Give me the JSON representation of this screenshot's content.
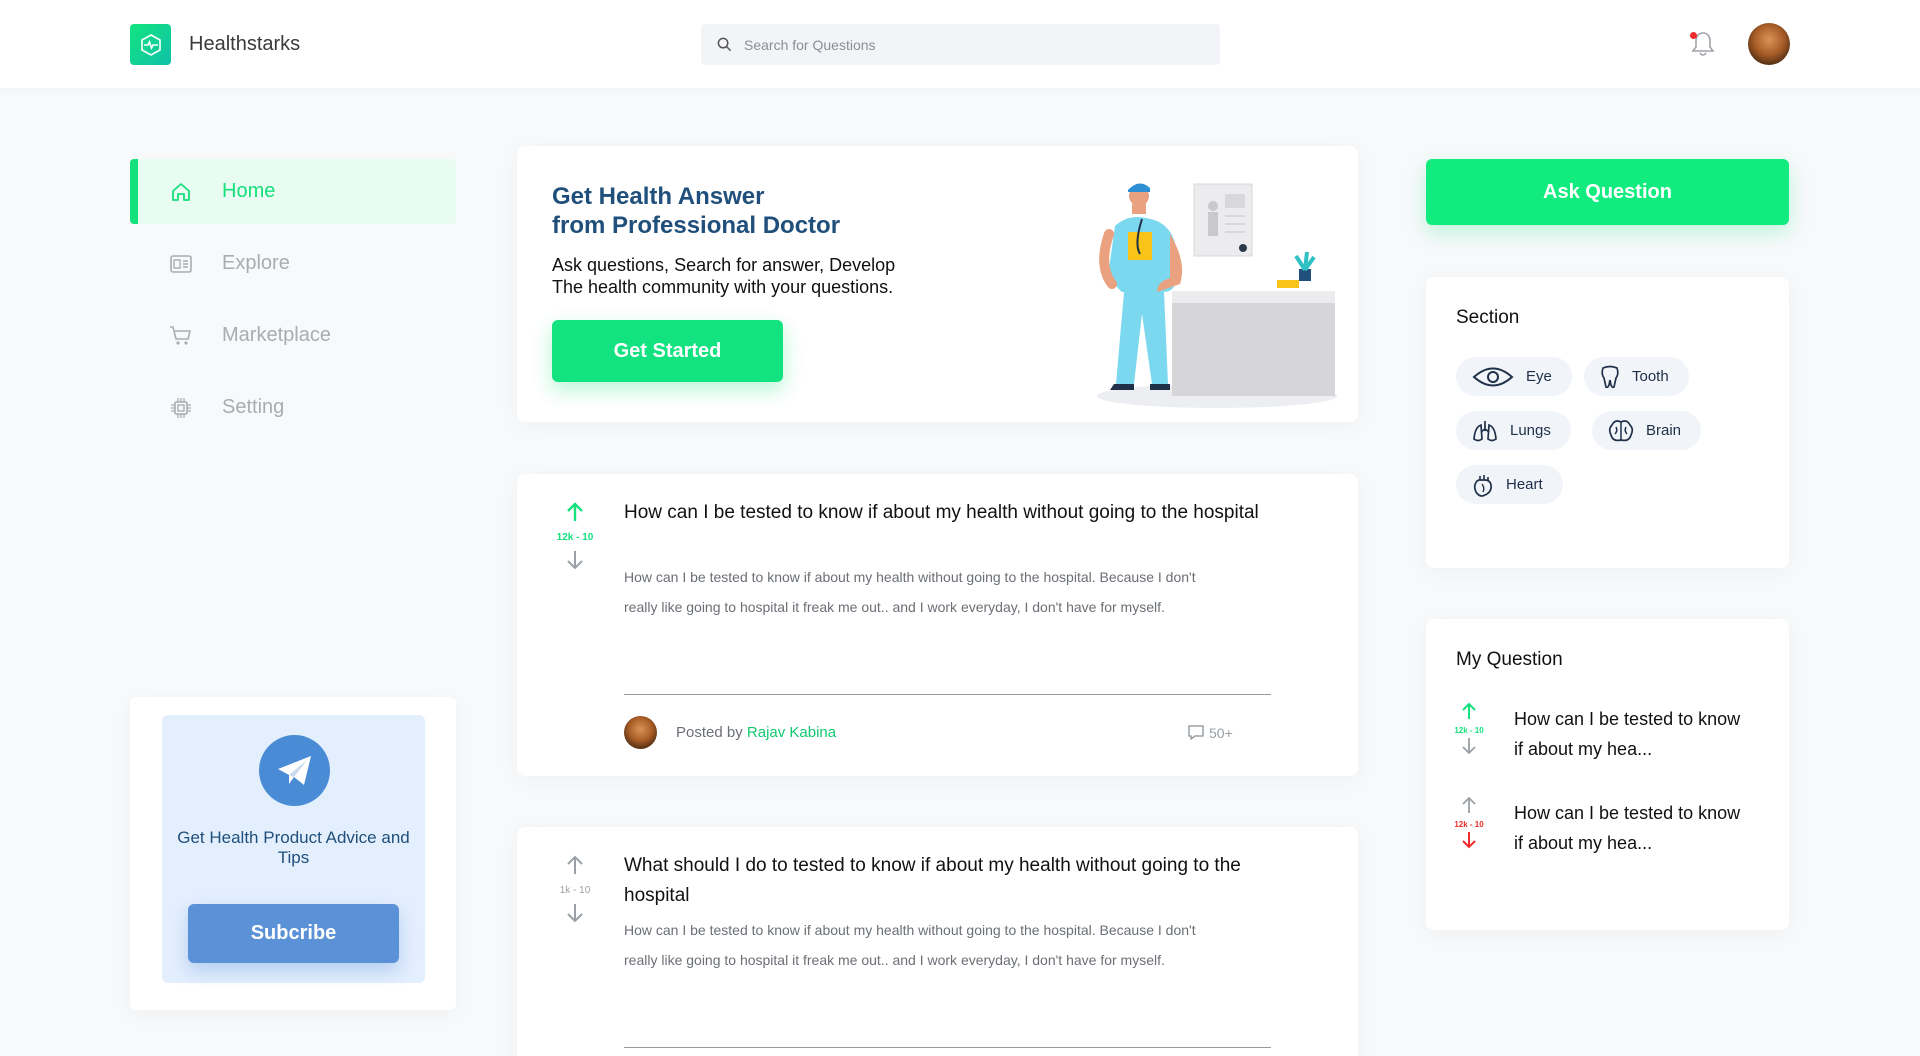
{
  "header": {
    "brand": "Healthstarks",
    "search_placeholder": "Search for Questions"
  },
  "sidebar": {
    "items": [
      {
        "label": "Home",
        "icon": "home-icon",
        "active": true
      },
      {
        "label": "Explore",
        "icon": "explore-icon",
        "active": false
      },
      {
        "label": "Marketplace",
        "icon": "cart-icon",
        "active": false
      },
      {
        "label": "Setting",
        "icon": "chip-icon",
        "active": false
      }
    ],
    "promo": {
      "text": "Get Health Product Advice and Tips",
      "button": "Subcribe",
      "icon": "telegram-icon"
    }
  },
  "hero": {
    "title": "Get Health Answer\nfrom Professional Doctor",
    "subtitle": "Ask questions, Search for answer, Develop\nThe health community with your questions.",
    "button": "Get Started"
  },
  "questions": [
    {
      "votes": "12k - 10",
      "title": "How can I be tested to know if about my health without going to the hospital",
      "body": "How can I be tested to know if about my health without going to the hospital. Because I don't really like going to hospital it freak me out.. and I work everyday, I don't have for myself.",
      "posted_by_label": "Posted by",
      "author": "Rajav Kabina",
      "comments": "50+"
    },
    {
      "votes": "1k - 10",
      "title": "What should I do to tested to know if about my health without going to the hospital",
      "body": "How can I be tested to know if about my health without going to the hospital. Because I don't really like going to hospital it freak me out.. and I work everyday, I don't have for myself."
    }
  ],
  "right": {
    "ask_button": "Ask Question",
    "section_title": "Section",
    "tags": [
      "Eye",
      "Tooth",
      "Lungs",
      "Brain",
      "Heart"
    ],
    "my_question_title": "My Question",
    "my_questions": [
      {
        "votes": "12k - 10",
        "title": "How can I be tested to know if about my hea...",
        "state": "up"
      },
      {
        "votes": "12k - 10",
        "title": "How can I be tested to know if about my hea...",
        "state": "down"
      }
    ]
  },
  "colors": {
    "accent": "#14e07c",
    "navy": "#1f4f7a",
    "subscribe": "#5b91d6",
    "downvote": "#ee2b2b"
  }
}
